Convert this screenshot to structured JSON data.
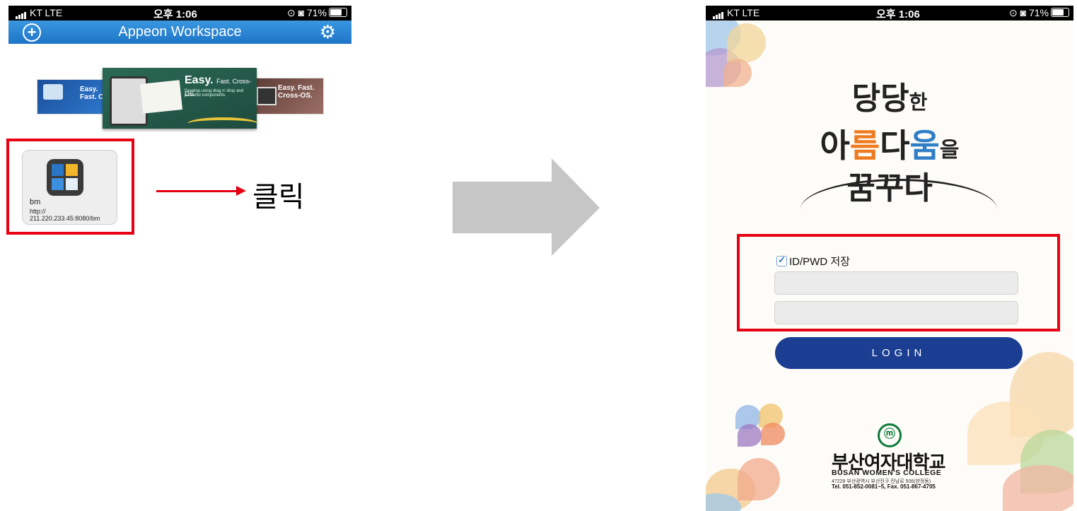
{
  "left_phone": {
    "status": {
      "carrier": "KT  LTE",
      "time": "오후 1:06",
      "battery": "71%"
    },
    "app_bar": {
      "title": "Appeon Workspace",
      "add_icon": "plus-circle-icon",
      "settings_icon": "gear-icon"
    },
    "banner": {
      "left_text": "Easy. Fast. Cro",
      "center_title": "Easy.",
      "center_title_suffix": "Fast. Cross-OS.",
      "center_sub": "Develop using drag n' drop and powerful components.",
      "right_text": "Easy. Fast. Cross-OS."
    },
    "app_tile": {
      "name": "bm",
      "url": "http:// 211.220.233.45:8080/bm"
    }
  },
  "annotation": {
    "click_label": "클릭",
    "highlight_color": "#e60012"
  },
  "right_phone": {
    "status": {
      "carrier": "KT  LTE",
      "time": "오후 1:06",
      "battery": "71%"
    },
    "slogan": {
      "line1_a": "당당",
      "line1_b": "한",
      "line2_a": "아",
      "line2_b": "름",
      "line2_c": "다",
      "line2_d": "움",
      "line2_e": "을",
      "line3": "꿈꾸다"
    },
    "login": {
      "save_label": "ID/PWD 저장",
      "save_checked": true,
      "id_placeholder": "",
      "pwd_placeholder": "",
      "button_label": "LOGIN",
      "button_color": "#1b3e93"
    },
    "college": {
      "emblem": "ⓜ",
      "name_kr": "부산여자대학교",
      "name_en": "BUSAN WOMEN'S COLLEGE",
      "address": "47228 부산광역시 부산진구 진남로 506(양정동)",
      "tel": "Tel. 051-852-0081~5, Fax. 051-867-4705"
    }
  }
}
